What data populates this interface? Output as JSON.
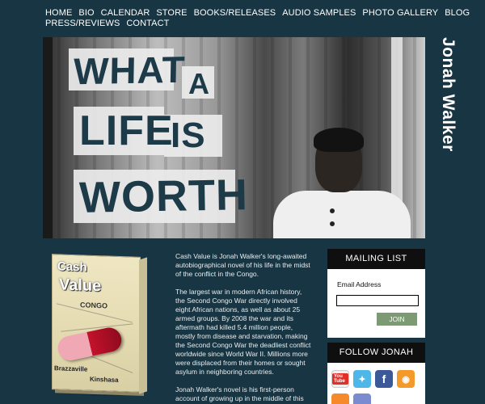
{
  "nav": {
    "row1": [
      "HOME",
      "BIO",
      "CALENDAR",
      "STORE",
      "BOOKS/RELEASES",
      "AUDIO SAMPLES",
      "PHOTO GALLERY",
      "BLOG"
    ],
    "row2": [
      "PRESS/REVIEWS",
      "CONTACT"
    ]
  },
  "hero": {
    "words": [
      "WHAT",
      "A",
      "LIFE",
      "IS",
      "WORTH"
    ],
    "artist_name": "Jonah Walker"
  },
  "book": {
    "title_line1": "Cash",
    "title_line2": "Value",
    "map_label": "CONGO",
    "city1": "Brazzaville",
    "city2": "Kinshasa"
  },
  "copy": {
    "p1": "Cash Value is Jonah Walker's long-awaited autobiographical novel of his life in the midst of the conflict in the Congo.",
    "p2": "The largest war in modern African history, the Second Congo War directly involved eight African nations, as well as about 25 armed groups. By 2008 the war and its aftermath had killed 5.4 million people, mostly from disease and starvation, making the Second Congo War the deadliest conflict worldwide since World War II. Millions more were displaced from their homes or sought asylum in neighboring countries.",
    "p3": "Jonah Walker's novel is his first-person account of growing up in the middle of this"
  },
  "mailing": {
    "heading": "MAILING LIST",
    "email_label": "Email Address",
    "email_value": "",
    "join_label": "JOIN"
  },
  "follow": {
    "heading": "FOLLOW JONAH",
    "icons": [
      "youtube-icon",
      "twitter-icon",
      "facebook-icon",
      "rss-icon",
      "blogger-icon",
      "flickr-icon"
    ],
    "youtube_text": "You Tube"
  },
  "colors": {
    "background": "#173543",
    "panel_header": "#0f0f0f",
    "join_button": "#7c9a74"
  }
}
